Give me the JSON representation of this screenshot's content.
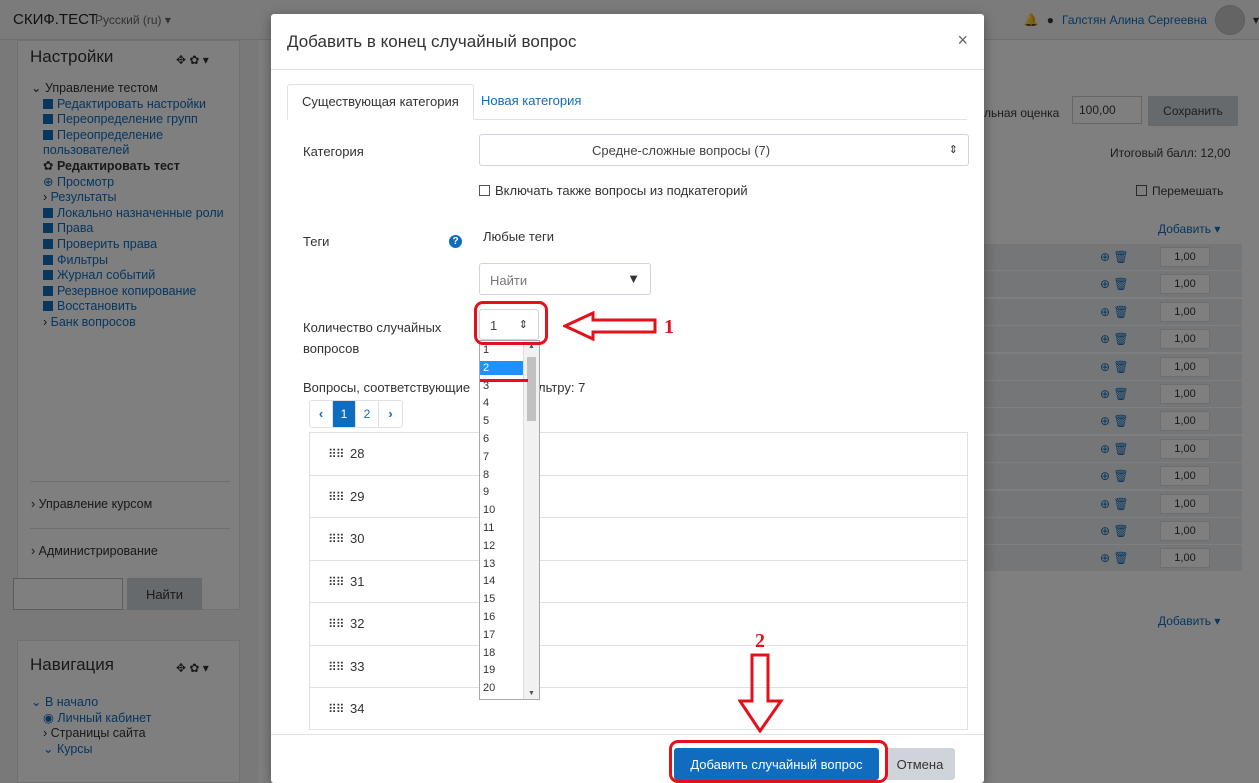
{
  "topbar": {
    "brand": "СКИФ.ТЕСТ",
    "language": "Русский (ru) ▾",
    "user_name": "Галстян Алина Сергеевна"
  },
  "sidebar": {
    "settings_title": "Настройки",
    "settings_controls": "✥ ✿ ▾",
    "quiz_admin": "⌄ Управление тестом",
    "items": [
      "Редактировать настройки",
      "Переопределение групп",
      "Переопределение пользователей",
      "Редактировать тест",
      "Просмотр",
      "Результаты",
      "Локально назначенные роли",
      "Права",
      "Проверить права",
      "Фильтры",
      "Журнал событий",
      "Резервное копирование",
      "Восстановить",
      "Банк вопросов"
    ],
    "course_admin": "› Управление курсом",
    "site_admin": "› Администрирование",
    "search_button": "Найти",
    "nav_title": "Навигация",
    "nav_controls": "✥ ✿ ▾",
    "nav_items": [
      "⌄ В начало",
      "Личный кабинет",
      "› Страницы сайта",
      "⌄ Курсы"
    ]
  },
  "main": {
    "max_grade_label": "льная оценка",
    "max_grade_value": "100,00",
    "save_button": "Сохранить",
    "total_label": "Итоговый балл: 12,00",
    "shuffle_label": "Перемешать",
    "add_label": "Добавить ▾",
    "marks": [
      "1,00",
      "1,00",
      "1,00",
      "1,00",
      "1,00",
      "1,00",
      "1,00",
      "1,00",
      "1,00",
      "1,00",
      "1,00",
      "1,00"
    ],
    "add_label_bottom": "Добавить ▾"
  },
  "modal": {
    "title": "Добавить в конец случайный вопрос",
    "close": "×",
    "tabs": [
      "Существующая категория",
      "Новая категория"
    ],
    "category_label": "Категория",
    "category_value": "Средне-сложные вопросы (7)",
    "include_subcats": "Включать также вопросы из подкатегорий",
    "tags_label": "Теги",
    "tags_help": "?",
    "tags_any": "Любые теги",
    "tags_search_placeholder": "Найти",
    "count_label_1": "Количество случайных",
    "count_label_2": "вопросов",
    "count_value": "1",
    "count_options": [
      "1",
      "2",
      "3",
      "4",
      "5",
      "6",
      "7",
      "8",
      "9",
      "10",
      "11",
      "12",
      "13",
      "14",
      "15",
      "16",
      "17",
      "18",
      "19",
      "20"
    ],
    "count_selected_option": "2",
    "matching_label_left": "Вопросы, соответствующие",
    "matching_label_right": "льтру: 7",
    "pager": [
      "‹",
      "1",
      "2",
      "›"
    ],
    "questions": [
      "28",
      "29",
      "30",
      "31",
      "32",
      "33",
      "34"
    ],
    "submit_button": "Добавить случайный вопрос",
    "cancel_button": "Отмена"
  },
  "annotations": {
    "label_1": "1",
    "label_2": "2"
  },
  "colors": {
    "accent": "#0f6cbf",
    "annotation": "#e3111b"
  }
}
